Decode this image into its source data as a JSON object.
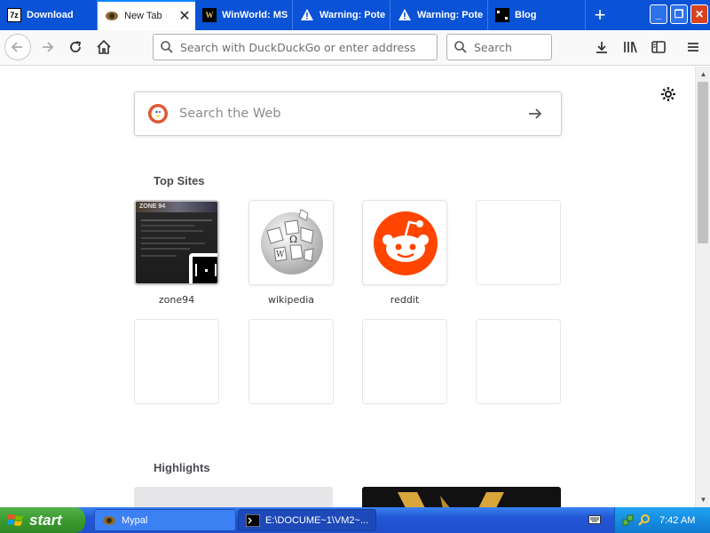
{
  "tabs": [
    {
      "label": "Download",
      "icon": "7zip-icon",
      "close": ""
    },
    {
      "label": "New Tab",
      "icon": "new-tab-icon",
      "close": "✕"
    },
    {
      "label": "WinWorld: MS",
      "icon": "winworld-icon",
      "close": ""
    },
    {
      "label": "Warning: Pote",
      "icon": "warning-icon",
      "close": ""
    },
    {
      "label": "Warning: Pote",
      "icon": "warning-icon",
      "close": ""
    },
    {
      "label": "Blog",
      "icon": "blog-icon",
      "close": ""
    }
  ],
  "tab_icons": {
    "sevenzip": "7z",
    "winworld": "W"
  },
  "new_tab_button": "+",
  "window_buttons": {
    "minimize": "_",
    "maximize": "❐",
    "close": "✕"
  },
  "navbar": {
    "url_placeholder": "Search with DuckDuckGo or enter address",
    "search_placeholder": "Search"
  },
  "newtab": {
    "web_search_placeholder": "Search the Web",
    "top_sites_title": "Top Sites",
    "highlights_title": "Highlights",
    "top_sites": [
      {
        "label": "zone94",
        "icon": "zone94-thumbnail"
      },
      {
        "label": "wikipedia",
        "icon": "wikipedia-icon"
      },
      {
        "label": "reddit",
        "icon": "reddit-icon"
      }
    ],
    "zone94_thumb_text": "ZONE 94"
  },
  "taskbar": {
    "start_label": "start",
    "tasks": [
      {
        "label": "Mypal",
        "icon": "mypal-icon"
      },
      {
        "label": "E:\\DOCUME~1\\VM2~...",
        "icon": "cmd-icon"
      }
    ],
    "clock": "7:42 AM"
  },
  "colors": {
    "tabstrip": "#0a52d6",
    "reddit": "#ff4500",
    "duckduckgo": "#de5833",
    "xp_start": "#3a9a30",
    "xp_tray": "#168de0"
  }
}
